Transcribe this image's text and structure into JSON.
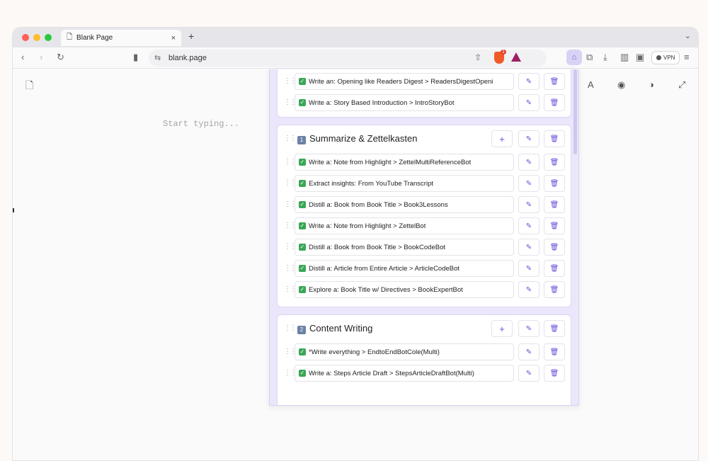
{
  "browser": {
    "tab_title": "Blank Page",
    "tab_close": "×",
    "new_tab": "+",
    "tab_menu": "⌄",
    "url": "blank.page",
    "vpn_label": "VPN",
    "brave_badge": "1"
  },
  "page": {
    "placeholder": "Start typing..."
  },
  "panel": {
    "section0_items": [
      "Write an: Opening like Readers Digest > ReadersDigestOpeni",
      "Write a: Story Based Introduction > IntroStoryBot"
    ],
    "section1": {
      "number": "1",
      "title": "Summarize & Zettelkasten",
      "items": [
        "Write a: Note from Highlight > ZettelMultiReferenceBot",
        "Extract insights: From YouTube Transcript",
        "Distill a: Book from Book Title > Book3Lessons",
        "Write a: Note from Highlight > ZettelBot",
        "Distill a: Book from Book Title > BookCodeBot",
        "Distill a: Article from Entire Article > ArticleCodeBot",
        "Explore a: Book Title w/ Directives > BookExpertBot"
      ]
    },
    "section2": {
      "number": "2",
      "title": "Content Writing",
      "items": [
        "*Write everything > EndtoEndBotCole(Multi)",
        "Write a: Steps Article Draft > StepsArticleDraftBot(Multi)"
      ]
    },
    "check_glyph": "✓",
    "add_glyph": "+",
    "edit_glyph": "✎",
    "delete_glyph": "🗑",
    "drag_glyph": "⋮⋮"
  },
  "colors": {
    "accent": "#6a4bd8",
    "check_green": "#3aa757",
    "panel_bg": "#ebe6fb"
  }
}
